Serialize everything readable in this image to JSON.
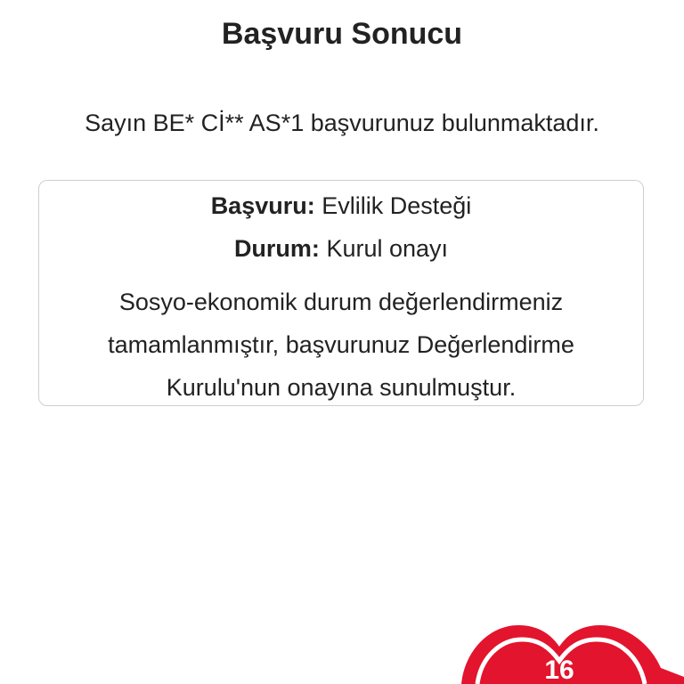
{
  "header": {
    "title": "Başvuru Sonucu"
  },
  "greeting": {
    "text": "Sayın BE* Cİ** AS*1 başvurunuz bulunmaktadır."
  },
  "result": {
    "application_label": "Başvuru:",
    "application_value": "Evlilik Desteği",
    "status_label": "Durum:",
    "status_value": "Kurul onayı",
    "description": "Sosyo-ekonomik durum değerlendirmeniz tamamlanmıştır, başvurunuz Değerlendirme Kurulu'nun onayına sunulmuştur."
  },
  "badge": {
    "icon": "heart-icon",
    "number": "16",
    "color": "#e3142d"
  }
}
